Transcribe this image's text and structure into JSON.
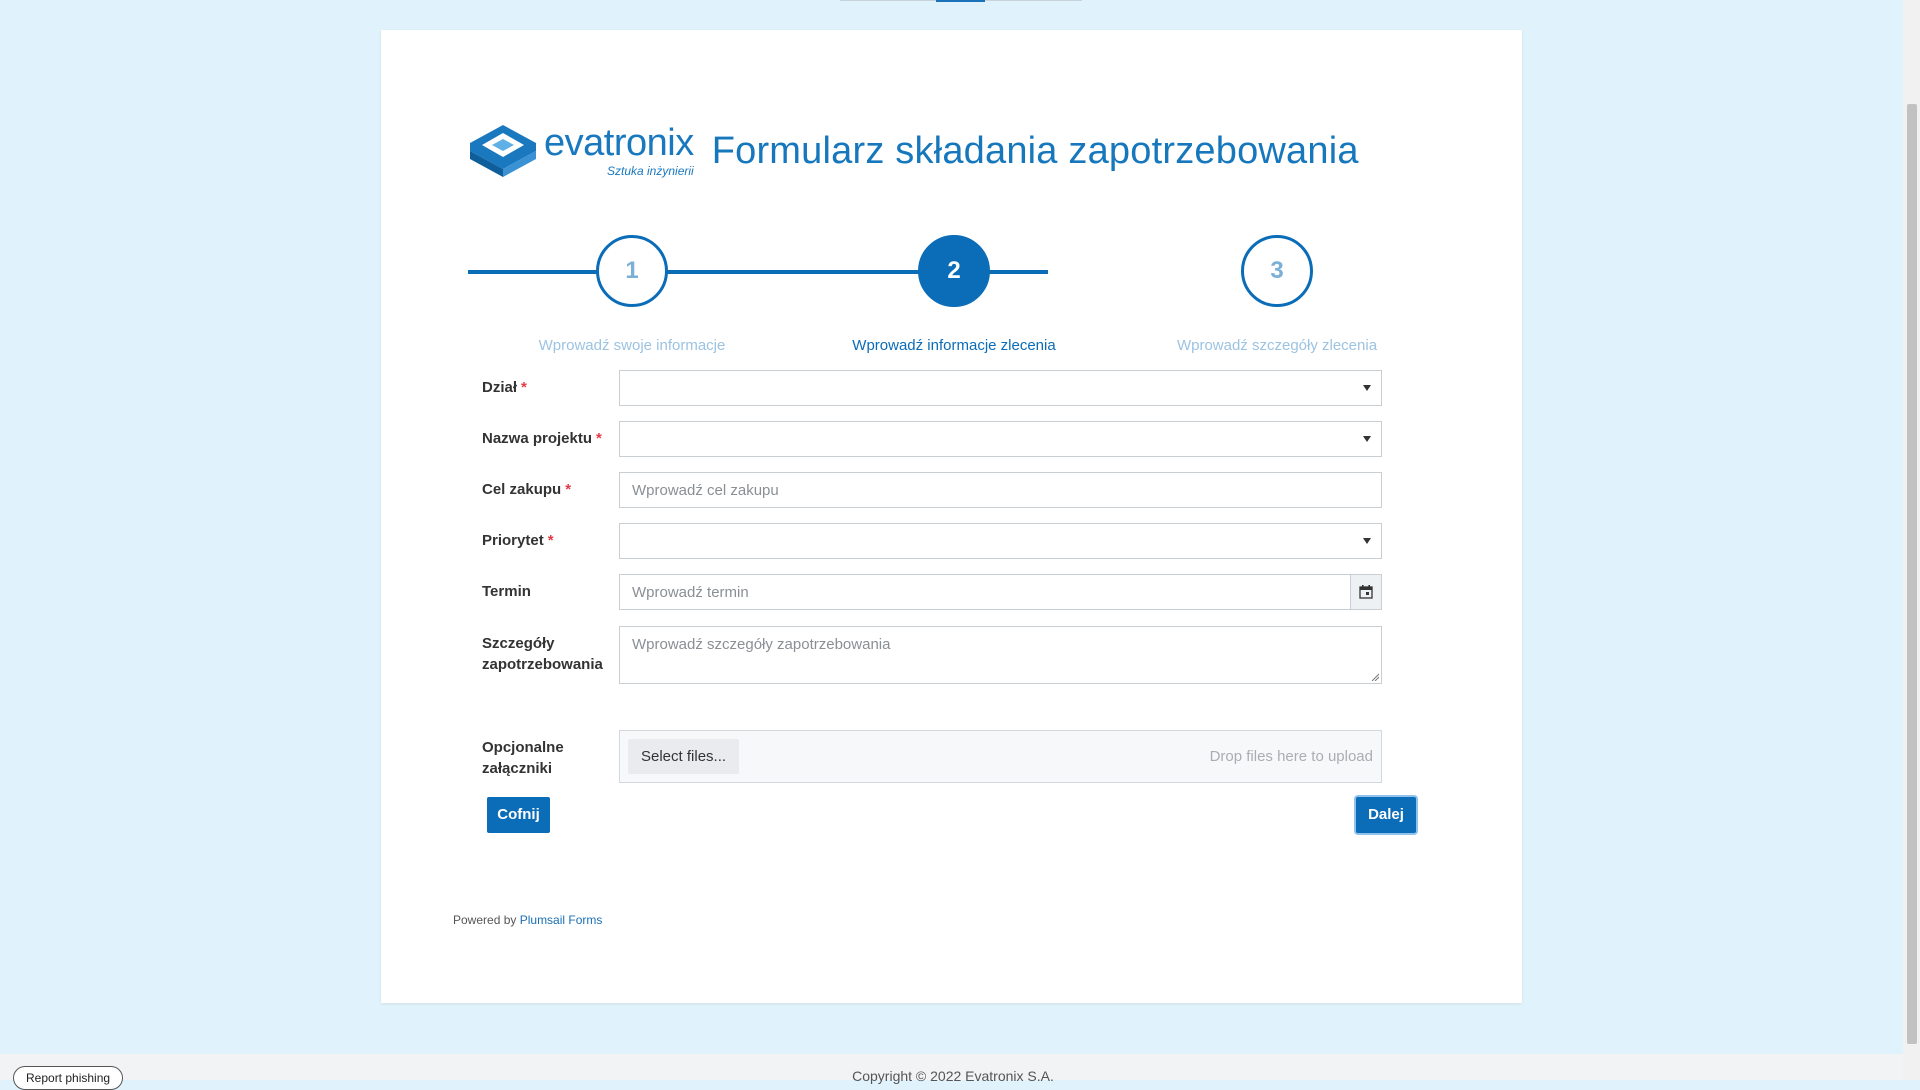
{
  "header": {
    "logo_text": "evatronix",
    "logo_tagline": "Sztuka inżynierii",
    "title": "Formularz składania zapotrzebowania"
  },
  "stepper": {
    "steps": [
      {
        "number": "1",
        "label": "Wprowadź swoje informacje",
        "active": false
      },
      {
        "number": "2",
        "label": "Wprowadź informacje zlecenia",
        "active": true
      },
      {
        "number": "3",
        "label": "Wprowadź szczegóły zlecenia",
        "active": false
      }
    ]
  },
  "form": {
    "dzial": {
      "label": "Dział",
      "required": "*",
      "value": ""
    },
    "nazwa_projektu": {
      "label": "Nazwa projektu",
      "required": "*",
      "value": ""
    },
    "cel_zakupu": {
      "label": "Cel zakupu",
      "required": "*",
      "placeholder": "Wprowadź cel zakupu"
    },
    "priorytet": {
      "label": "Priorytet",
      "required": "*",
      "value": ""
    },
    "termin": {
      "label": "Termin",
      "placeholder": "Wprowadź termin"
    },
    "szczegoly": {
      "label_line1": "Szczegóły",
      "label_line2": "zapotrzebowania",
      "placeholder": "Wprowadź szczegóły zapotrzebowania"
    },
    "zalaczniki": {
      "label_line1": "Opcjonalne",
      "label_line2": "załączniki",
      "select_label": "Select files...",
      "drop_text": "Drop files here to upload"
    }
  },
  "buttons": {
    "back": "Cofnij",
    "next": "Dalej"
  },
  "footer": {
    "powered_prefix": "Powered by",
    "powered_link": "Plumsail Forms",
    "copyright": "Copyright © 2022 Evatronix S.A.",
    "report_phishing": "Report phishing"
  },
  "colors": {
    "accent": "#0b6cb7",
    "background": "#e0f2fb"
  }
}
